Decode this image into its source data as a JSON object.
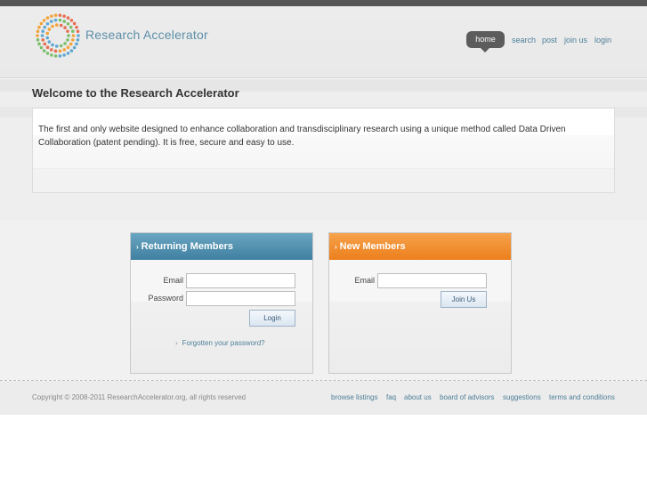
{
  "header": {
    "logo_text": "Research Accelerator",
    "nav": {
      "home": "home",
      "search": "search",
      "post": "post",
      "join": "join us",
      "login": "login"
    }
  },
  "welcome": {
    "title": "Welcome to the Research Accelerator",
    "intro": "The first and only website designed to enhance collaboration and transdisciplinary research using a unique method called Data Driven Collaboration (patent pending). It is free, secure and easy to use."
  },
  "returning": {
    "heading": "Returning Members",
    "email_label": "Email",
    "email_value": "",
    "password_label": "Password",
    "password_value": "",
    "login_button": "Login",
    "forgot_link": "Forgotten your password?"
  },
  "new_members": {
    "heading": "New Members",
    "email_label": "Email",
    "email_value": "",
    "join_button": "Join Us"
  },
  "footer": {
    "copyright": "Copyright © 2008-2011 ResearchAccelerator.org, all rights reserved",
    "links": {
      "browse": "browse listings",
      "faq": "faq",
      "about": "about us",
      "board": "board of advisors",
      "suggestions": "suggestions",
      "terms": "terms and conditions"
    }
  },
  "colors": {
    "accent_blue": "#4d7f99",
    "returning_header": "#3f7fa0",
    "new_header": "#ec7f1c",
    "nav_active": "#5c5c5c"
  }
}
